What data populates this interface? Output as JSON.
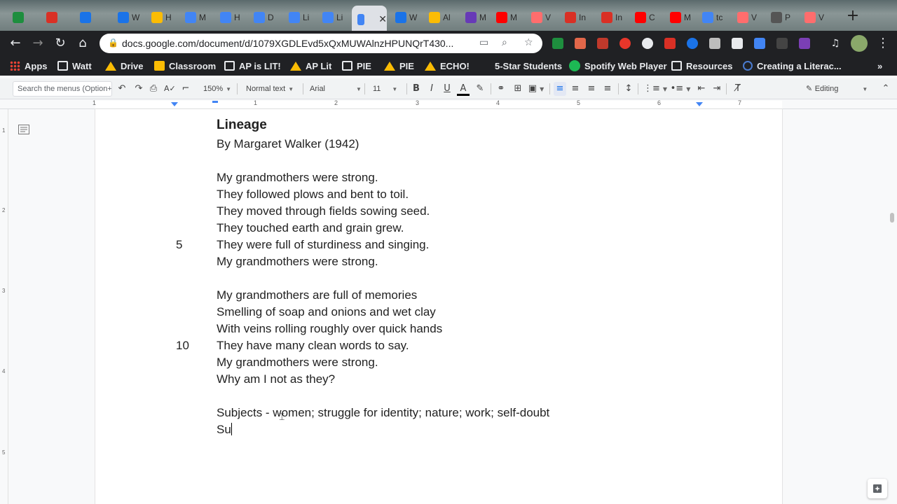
{
  "browser": {
    "tabs": [
      {
        "icon": "classroom-icon",
        "color": "#1e8e3e",
        "title": ""
      },
      {
        "icon": "gmail-icon",
        "color": "#d93025",
        "title": ""
      },
      {
        "icon": "meet-icon",
        "color": "#1a73e8",
        "title": ""
      },
      {
        "icon": "contacts-icon",
        "color": "#1a73e8",
        "title": "W"
      },
      {
        "icon": "drive-icon",
        "color": "#fbbc04",
        "title": "H"
      },
      {
        "icon": "docs-icon",
        "color": "#4285f4",
        "title": "M"
      },
      {
        "icon": "docs-icon",
        "color": "#4285f4",
        "title": "H"
      },
      {
        "icon": "docs-icon",
        "color": "#4285f4",
        "title": "D"
      },
      {
        "icon": "docs-icon",
        "color": "#4285f4",
        "title": "Li"
      },
      {
        "icon": "docs-icon",
        "color": "#4285f4",
        "title": "Li"
      },
      {
        "icon": "docs-icon",
        "color": "#4285f4",
        "title": "",
        "active": true
      },
      {
        "icon": "contacts-icon",
        "color": "#1a73e8",
        "title": "W"
      },
      {
        "icon": "drive-icon",
        "color": "#fbbc04",
        "title": "Al"
      },
      {
        "icon": "forms-icon",
        "color": "#673ab7",
        "title": "M"
      },
      {
        "icon": "youtube-icon",
        "color": "#ff0000",
        "title": "M"
      },
      {
        "icon": "video-icon",
        "color": "#ff6d6d",
        "title": "V"
      },
      {
        "icon": "gmail-icon",
        "color": "#d93025",
        "title": "In"
      },
      {
        "icon": "gmail-icon",
        "color": "#d93025",
        "title": "In"
      },
      {
        "icon": "youtube-icon",
        "color": "#ff0000",
        "title": "C"
      },
      {
        "icon": "youtube-icon",
        "color": "#ff0000",
        "title": "M"
      },
      {
        "icon": "google-icon",
        "color": "#4285f4",
        "title": "tc"
      },
      {
        "icon": "video-icon",
        "color": "#ff6d6d",
        "title": "V"
      },
      {
        "icon": "pin-icon",
        "color": "#555555",
        "title": "P"
      },
      {
        "icon": "video-icon",
        "color": "#ff6d6d",
        "title": "V"
      }
    ],
    "active_tab_close": "✕",
    "new_tab": "+",
    "url": "docs.google.com/document/d/1079XGDLEvd5xQxMUWAlnzHPUNQrT430...",
    "bookmarks": [
      {
        "label": "Apps",
        "icon": "apps-icon"
      },
      {
        "label": "Watt",
        "icon": "folder-icon"
      },
      {
        "label": "Drive",
        "icon": "drive-icon"
      },
      {
        "label": "Classroom",
        "icon": "classroom-icon"
      },
      {
        "label": "AP is LIT!",
        "icon": "folder-icon"
      },
      {
        "label": "AP Lit",
        "icon": "drive-icon"
      },
      {
        "label": "PIE",
        "icon": "folder-icon"
      },
      {
        "label": "PIE",
        "icon": "drive-icon"
      },
      {
        "label": "ECHO!",
        "icon": "drive-icon"
      },
      {
        "label": "5-Star Students",
        "icon": "blank"
      },
      {
        "label": "Spotify Web Player",
        "icon": "spotify-icon"
      },
      {
        "label": "Resources",
        "icon": "folder-icon"
      },
      {
        "label": "Creating a Literac...",
        "icon": "globe-icon"
      }
    ],
    "more_bookmarks": "»"
  },
  "toolbar": {
    "search_menus": "Search the menus (Option+/)",
    "zoom": "150%",
    "style": "Normal text",
    "font": "Arial",
    "size": "11",
    "mode": "Editing"
  },
  "ruler": {
    "numbers": [
      "1",
      "1",
      "2",
      "3",
      "4",
      "5",
      "6",
      "7"
    ],
    "side_numbers": [
      "1",
      "2",
      "3",
      "4",
      "5"
    ]
  },
  "document": {
    "title": "Lineage",
    "byline": "By Margaret Walker (1942)",
    "stanza1": [
      "My grandmothers were strong.",
      "They followed plows and bent to toil.",
      "They moved through fields sowing seed.",
      "They touched earth and grain grew.",
      "They were full of sturdiness and singing.",
      "My grandmothers were strong."
    ],
    "stanza2": [
      "My grandmothers are full of memories",
      "Smelling of soap and onions and wet clay",
      "With veins rolling roughly over quick hands",
      "They have many clean words to say.",
      "My grandmothers were strong.",
      "Why am I not as they?"
    ],
    "line_number_5": "5",
    "line_number_10": "10",
    "notes": [
      "Subjects - women; struggle for identity; nature; work; self-doubt",
      "Su"
    ]
  }
}
